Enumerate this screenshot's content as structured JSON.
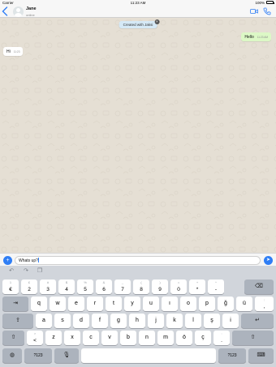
{
  "status_bar": {
    "carrier": "Carrier",
    "time": "11:23 AM",
    "battery": "100%"
  },
  "header": {
    "back_icon": "chevron-left-icon",
    "contact_name": "Jane",
    "contact_status": "online",
    "video_icon": "video-call-icon",
    "call_icon": "phone-call-icon",
    "accent_color": "#2f7ef5"
  },
  "chat": {
    "system_message": "Created with Jaksi",
    "system_close": "×",
    "messages": [
      {
        "direction": "outgoing",
        "text": "Hello",
        "time": "11:23 AM"
      },
      {
        "direction": "incoming",
        "text": "Hi",
        "time": "11:23"
      }
    ],
    "outgoing_bubble_color": "#dcf8c6"
  },
  "input": {
    "value": "Whats up?",
    "plus_icon": "plus-icon",
    "send_icon": "send-icon"
  },
  "keyboard": {
    "toolbar": [
      "undo-icon",
      "redo-icon",
      "paste-icon"
    ],
    "row1": [
      {
        "main": "€",
        "sub": "1"
      },
      {
        "main": "2",
        "sub": "£"
      },
      {
        "main": "3",
        "sub": "#"
      },
      {
        "main": "4",
        "sub": "$"
      },
      {
        "main": "5",
        "sub": "%"
      },
      {
        "main": "6",
        "sub": "&"
      },
      {
        "main": "7",
        "sub": "_"
      },
      {
        "main": "8",
        "sub": "("
      },
      {
        "main": "9",
        "sub": ")"
      },
      {
        "main": "0",
        "sub": "="
      },
      {
        "main": "*",
        "sub": "+"
      },
      {
        "main": "-",
        "sub": "^"
      }
    ],
    "row2": [
      "q",
      "w",
      "e",
      "r",
      "t",
      "y",
      "u",
      "ı",
      "o",
      "p",
      "ğ",
      "ü"
    ],
    "row2_punct": {
      "main": ",",
      "sub": ";"
    },
    "row3": [
      "a",
      "s",
      "d",
      "f",
      "g",
      "h",
      "j",
      "k",
      "l",
      "ş",
      "i"
    ],
    "row4_first": {
      "main": "<",
      "sub": ">"
    },
    "row4": [
      "z",
      "x",
      "c",
      "v",
      "b",
      "n",
      "m",
      "ö",
      "ç"
    ],
    "row4_punct": {
      "main": ".",
      "sub": ":"
    },
    "numbers_label": "?123"
  }
}
